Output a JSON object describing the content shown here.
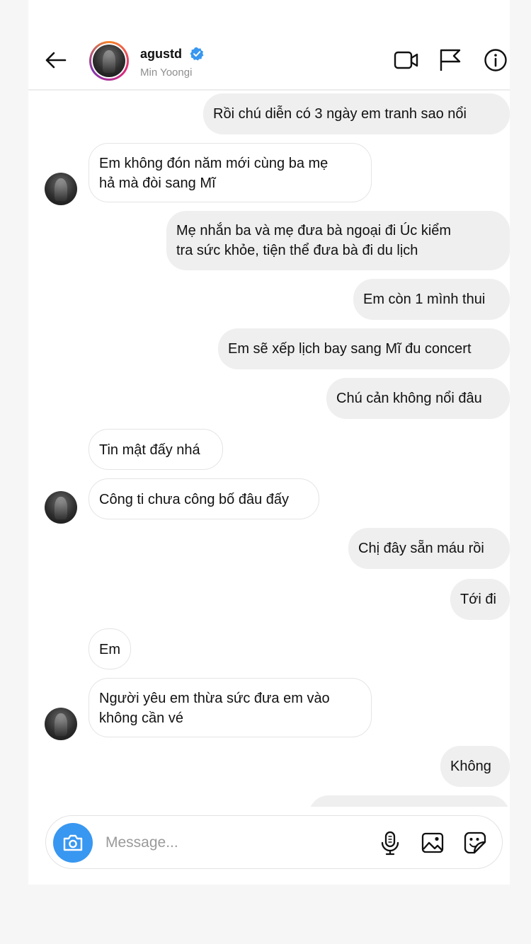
{
  "header": {
    "username": "agustd",
    "real_name": "Min Yoongi"
  },
  "messages": [
    {
      "side": "out",
      "text": "Rồi chú diễn có 3 ngày em tranh sao nổi"
    },
    {
      "side": "in",
      "text": "Em không đón năm mới cùng ba mẹ\nhả mà đòi sang Mĩ"
    },
    {
      "side": "out",
      "text": "Mẹ nhắn ba và mẹ đưa bà ngoại đi Úc kiểm\ntra sức khỏe, tiện thể đưa bà đi du lịch"
    },
    {
      "side": "out",
      "text": "Em còn 1 mình thui"
    },
    {
      "side": "out",
      "text": "Em sẽ xếp lịch bay sang Mĩ đu concert"
    },
    {
      "side": "out",
      "text": "Chú cản không nổi đâu"
    },
    {
      "side": "in",
      "text": "Tin mật đấy nhá"
    },
    {
      "side": "in",
      "text": "Công ti chưa công bố đâu đấy"
    },
    {
      "side": "out",
      "text": "Chị đây sẵn máu rồi"
    },
    {
      "side": "out",
      "text": "Tới đi"
    },
    {
      "side": "in",
      "text": "Em"
    },
    {
      "side": "in",
      "text": "Người yêu em thừa sức đưa em vào\nkhông cần vé"
    },
    {
      "side": "out",
      "text": "Không"
    }
  ],
  "composer": {
    "placeholder": "Message..."
  },
  "icons": {
    "back": "arrow-left-icon",
    "verified": "verified-badge-icon",
    "video": "video-call-icon",
    "flag": "flag-icon",
    "info": "info-icon",
    "camera": "camera-icon",
    "mic": "microphone-icon",
    "gallery": "image-icon",
    "sticker": "sticker-icon"
  },
  "colors": {
    "accent": "#3897f0",
    "outgoing_bubble": "#efefef",
    "incoming_border": "#e4e4e4"
  }
}
